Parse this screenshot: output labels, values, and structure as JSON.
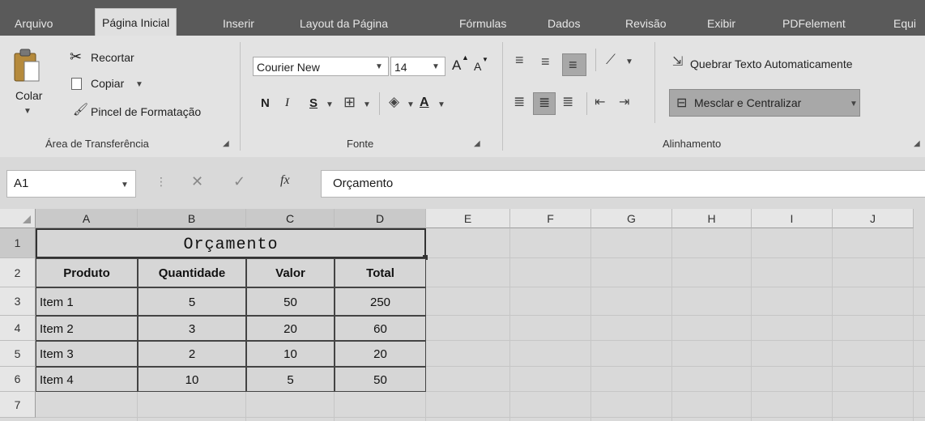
{
  "tabs": [
    "Arquivo",
    "Página Inicial",
    "Inserir",
    "Layout da Página",
    "Fórmulas",
    "Dados",
    "Revisão",
    "Exibir",
    "PDFelement",
    "Equi"
  ],
  "active_tab": "Página Inicial",
  "clipboard": {
    "paste": "Colar",
    "cut": "Recortar",
    "copy": "Copiar",
    "format_painter": "Pincel de Formatação",
    "group_label": "Área de Transferência"
  },
  "font": {
    "family": "Courier New",
    "size": "14",
    "bold": "N",
    "italic": "I",
    "underline": "S",
    "grow": "A",
    "shrink": "A",
    "font_color": "A",
    "group_label": "Fonte"
  },
  "alignment": {
    "wrap_text": "Quebrar Texto Automaticamente",
    "merge_center": "Mesclar e Centralizar",
    "group_label": "Alinhamento"
  },
  "formula_bar": {
    "name_box": "A1",
    "fx": "fx",
    "value": "Orçamento"
  },
  "columns": [
    "A",
    "B",
    "C",
    "D",
    "E",
    "F",
    "G",
    "H",
    "I",
    "J"
  ],
  "rows": [
    "1",
    "2",
    "3",
    "4",
    "5",
    "6",
    "7"
  ],
  "sheet": {
    "title": "Orçamento",
    "headers": [
      "Produto",
      "Quantidade",
      "Valor",
      "Total"
    ],
    "data": [
      [
        "Item 1",
        "5",
        "50",
        "250"
      ],
      [
        "Item 2",
        "3",
        "20",
        "60"
      ],
      [
        "Item 3",
        "2",
        "10",
        "20"
      ],
      [
        "Item 4",
        "10",
        "5",
        "50"
      ]
    ]
  }
}
